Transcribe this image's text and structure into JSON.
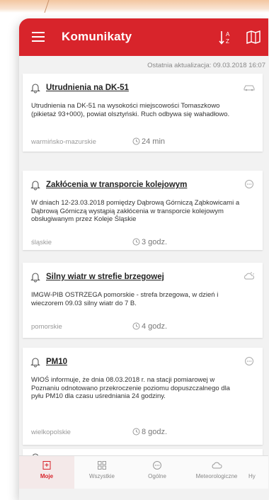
{
  "app": {
    "title": "Komunikaty",
    "last_update": "Ostatnia aktualizacja: 09.03.2018 16:07",
    "accent": "#d8242b"
  },
  "messages": [
    {
      "title": "Utrudnienia na DK-51",
      "body": "Utrudnienia na DK-51 na wysokości miejscowości Tomaszkowo (pikietaż 93+000), powiat olsztyński. Ruch odbywa się wahadłowo.",
      "region": "warmińsko-mazurskie",
      "time": "24 min",
      "category_icon": "car-icon"
    },
    {
      "title": "Zakłócenia w transporcie kolejowym",
      "body": "W dniach 12-23.03.2018 pomiędzy Dąbrową Górniczą Ząbkowicami a Dąbrową Górniczą wystąpią zakłócenia w transporcie kolejowym obsługiwanym przez Koleje Śląskie",
      "region": "śląskie",
      "time": "3 godz.",
      "category_icon": "more-icon"
    },
    {
      "title": "Silny wiatr w strefie brzegowej",
      "body": "IMGW-PIB OSTRZEGA pomorskie - strefa brzegowa, w dzień i wieczorem 09.03 silny wiatr do 7 B.",
      "region": "pomorskie",
      "time": "4 godz.",
      "category_icon": "weather-icon"
    },
    {
      "title": "PM10",
      "body": "WIOŚ informuje, że dnia 08.03.2018 r. na stacji pomiarowej w Poznaniu odnotowano przekroczenie poziomu dopuszczalnego dla pyłu PM10 dla czasu uśredniania 24 godziny.",
      "region": "wielkopolskie",
      "time": "8 godz.",
      "category_icon": "more-icon"
    }
  ],
  "tabs": [
    {
      "label": "Moje",
      "icon": "my-messages-icon",
      "active": true
    },
    {
      "label": "Wszystkie",
      "icon": "all-messages-icon",
      "active": false
    },
    {
      "label": "Ogólne",
      "icon": "general-icon",
      "active": false
    },
    {
      "label": "Meteorologiczne",
      "icon": "weather-icon",
      "active": false
    },
    {
      "label": "Hy",
      "icon": "",
      "active": false
    }
  ]
}
